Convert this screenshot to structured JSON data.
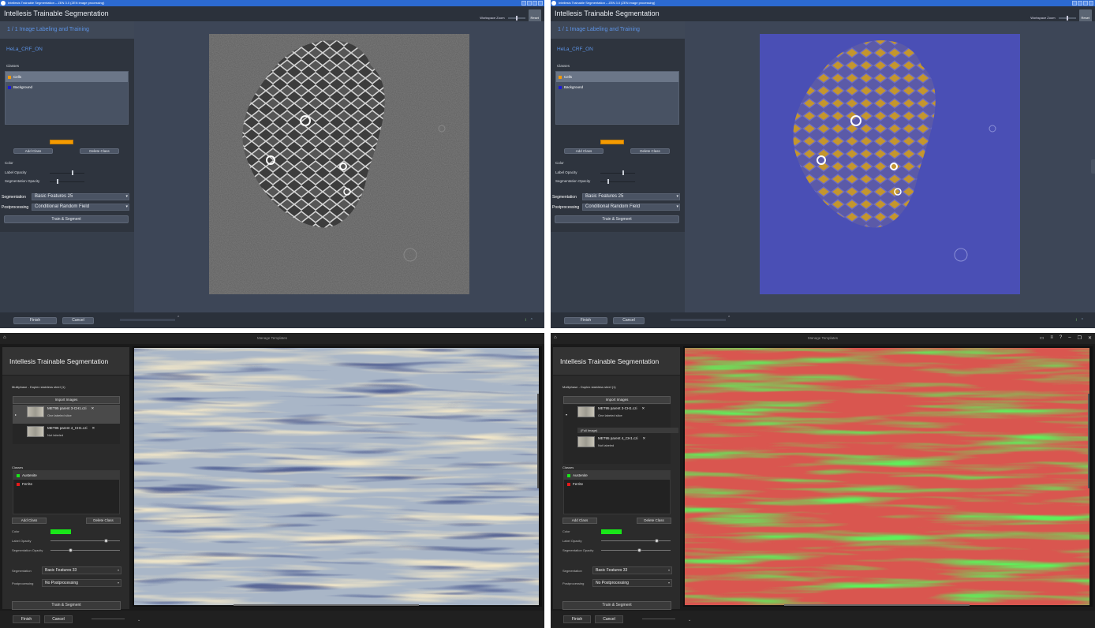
{
  "top_left": {
    "window_title": "Intellesis Trainable Segmentation – ZEN 3.0 (ZEN image processing)",
    "app_title": "Intellesis Trainable Segmentation",
    "workspace_zoom_label": "Workspace Zoom",
    "reset_label": "Reset",
    "step": "1 / 1   Image Labeling and Training",
    "project": "HeLa_CRF_ON",
    "classes_label": "Classes",
    "classes": [
      {
        "name": "Cells",
        "color": "#f59b00"
      },
      {
        "name": "Background",
        "color": "#1a1ad9"
      }
    ],
    "add_class": "Add Class",
    "delete_class": "Delete Class",
    "color_label": "Color",
    "label_opacity": "Label Opacity",
    "label_opacity_value": 0.65,
    "segmentation_opacity": "Segmentation Opacity",
    "segmentation_opacity_value": 0.5,
    "segmentation_label": "Segmentation",
    "segmentation_value": "Basic Features 25",
    "postprocessing_label": "Postprocessing",
    "postprocessing_value": "Conditional Random Field",
    "train_segment": "Train & Segment",
    "finish": "Finish",
    "cancel": "Cancel"
  },
  "top_right": {
    "window_title": "Intellesis Trainable Segmentation – ZEN 3.0 (ZEN image processing)",
    "app_title": "Intellesis Trainable Segmentation",
    "workspace_zoom_label": "Workspace Zoom",
    "reset_label": "Reset",
    "step": "1 / 1   Image Labeling and Training",
    "project": "HeLa_CRF_ON",
    "classes_label": "Classes",
    "classes": [
      {
        "name": "Cells",
        "color": "#f59b00"
      },
      {
        "name": "Background",
        "color": "#1a1ad9"
      }
    ],
    "add_class": "Add Class",
    "delete_class": "Delete Class",
    "color_label": "Color",
    "label_opacity": "Label Opacity",
    "label_opacity_value": 0.65,
    "segmentation_opacity": "Segmentation Opacity",
    "segmentation_opacity_value": 0.5,
    "segmentation_label": "Segmentation",
    "segmentation_value": "Basic Features 25",
    "postprocessing_label": "Postprocessing",
    "postprocessing_value": "Conditional Random Field",
    "train_segment": "Train & Segment",
    "finish": "Finish",
    "cancel": "Cancel"
  },
  "bottom_left": {
    "top_center": "Manage Templates",
    "app_title": "Intellesis Trainable Segmentation",
    "project": "Multiphase - Duplex stainless steel (1)",
    "import_images": "Import Images",
    "images": [
      {
        "name": "MET95 parent 3-CH1.czi",
        "status": "One labeled slice"
      },
      {
        "name": "MET95 parent 4_CH1.czi",
        "status": "Not labeled"
      }
    ],
    "full_image": "",
    "classes_label": "Classes",
    "classes": [
      {
        "name": "Austenite",
        "color": "#19e619"
      },
      {
        "name": "Ferrite",
        "color": "#e61919"
      }
    ],
    "add_class": "Add Class",
    "delete_class": "Delete Class",
    "color_label": "Color",
    "label_opacity": "Label Opacity",
    "label_opacity_value": 0.8,
    "segmentation_opacity": "Segmentation Opacity",
    "segmentation_opacity_value": 0.28,
    "segmentation_label": "Segmentation",
    "segmentation_value": "Basic Features 33",
    "postprocessing_label": "Postprocessing",
    "postprocessing_value": "No Postprocessing",
    "train_segment": "Train & Segment",
    "finish": "Finish",
    "cancel": "Cancel"
  },
  "bottom_right": {
    "top_center": "Manage Templates",
    "app_title": "Intellesis Trainable Segmentation",
    "project": "Multiphase - Duplex stainless steel (1)",
    "import_images": "Import Images",
    "images": [
      {
        "name": "MET95 parent 3-CH1.czi",
        "status": "One labeled slice"
      },
      {
        "name": "MET95 parent 4_CH1.czi",
        "status": "Not labeled"
      }
    ],
    "full_image": "(Full Image)",
    "classes_label": "Classes",
    "classes": [
      {
        "name": "Austenite",
        "color": "#19e619"
      },
      {
        "name": "Ferrite",
        "color": "#e61919"
      }
    ],
    "add_class": "Add Class",
    "delete_class": "Delete Class",
    "color_label": "Color",
    "label_opacity": "Label Opacity",
    "label_opacity_value": 0.8,
    "segmentation_opacity": "Segmentation Opacity",
    "segmentation_opacity_value": 0.55,
    "segmentation_label": "Segmentation",
    "segmentation_value": "Basic Features 33",
    "postprocessing_label": "Postprocessing",
    "postprocessing_value": "No Postprocessing",
    "train_segment": "Train & Segment",
    "finish": "Finish",
    "cancel": "Cancel"
  },
  "colors": {
    "zen_blue_title": "#2c6ad1",
    "zen_accent_text": "#5c93e6",
    "cells_overlay": "#c8962a",
    "background_overlay": "#4a4fb5",
    "austenite_overlay": "#5ef05a",
    "ferrite_overlay": "#d9564f"
  }
}
